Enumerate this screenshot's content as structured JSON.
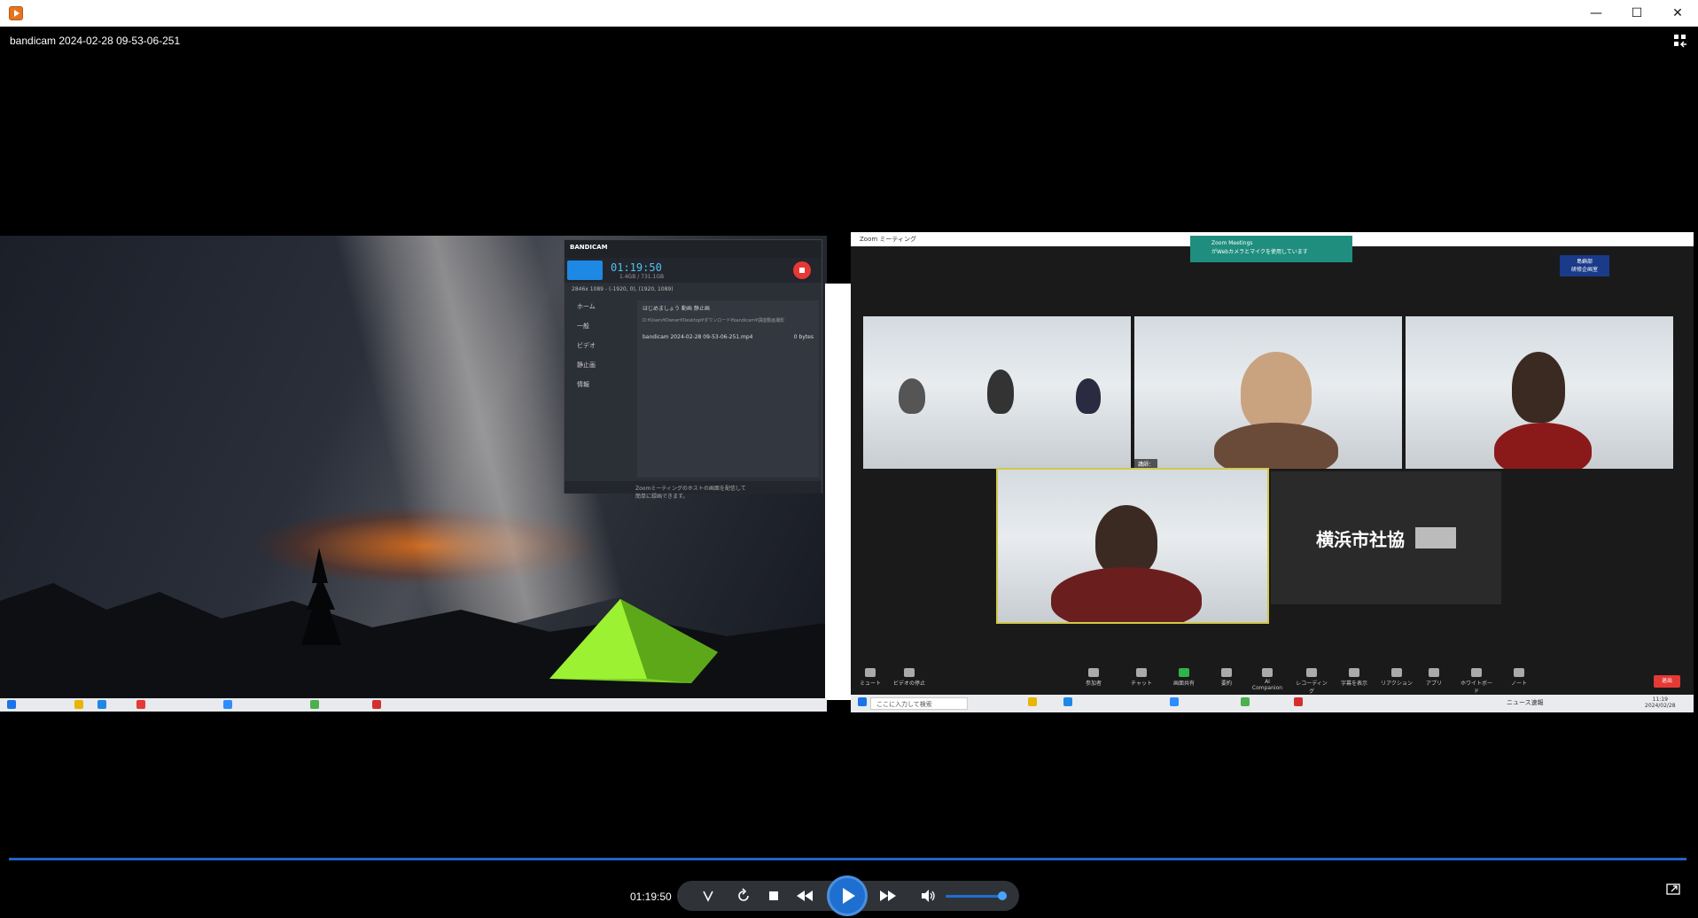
{
  "window": {
    "title": "bandicam 2024-02-28 09-53-06-251",
    "minimize": "—",
    "maximize": "☐",
    "close": "✕"
  },
  "bandicam": {
    "brand": "BANDICAM",
    "timer": "01:19:50",
    "size_text": "1.4GB / 731.1GB",
    "info": "2846x 1089 - (-1920, 0), (1920, 1089)",
    "sidebar": [
      "ホーム",
      "一般",
      "ビデオ",
      "静止画",
      "情報"
    ],
    "tabs": "はじめましょう    動画    静止画",
    "path": "D:¥Users¥Owner¥Desktop¥ダウンロード¥bandicam¥講座動画撮影",
    "file": "bandicam 2024-02-28 09-53-06-251.mp4",
    "file_size": "0 bytes",
    "footer": "Zoomミーティングのホストの画面を配信して簡単に録画できます。"
  },
  "zoom": {
    "window_title": "Zoom ミーティング",
    "notice_title": "Zoom Meetings",
    "notice_text": "がWebカメラとマイクを使用しています",
    "badge": "表示",
    "badge_label": "島嶼部\n研修企画室",
    "speaker_label": "講師：",
    "name_tile": "横浜市社協",
    "toolbar": [
      "ミュート",
      "ビデオの停止",
      "参加者",
      "チャット",
      "画面共有",
      "要約",
      "AI Companion",
      "レコーディング",
      "字幕を表示",
      "リアクション",
      "アプリ",
      "ホワイトボード",
      "ノート"
    ],
    "end": "退出"
  },
  "taskbar": {
    "search": "ここに入力して検索",
    "news": "ニュース速報",
    "time": "11:19",
    "date": "2024/02/28"
  },
  "player": {
    "time": "01:19:50",
    "progress": 0.999,
    "volume": 0.82
  }
}
